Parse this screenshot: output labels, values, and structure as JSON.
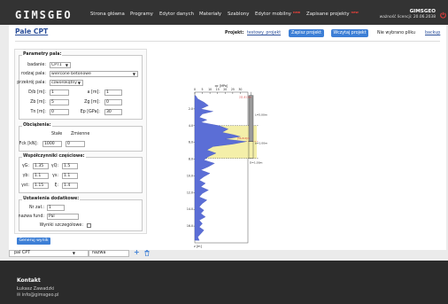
{
  "logo": "GIMSGEO",
  "nav": {
    "items": [
      {
        "label": "Strona główna",
        "new": ""
      },
      {
        "label": "Programy",
        "new": ""
      },
      {
        "label": "Edytor danych",
        "new": ""
      },
      {
        "label": "Materiały",
        "new": ""
      },
      {
        "label": "Szablony",
        "new": ""
      },
      {
        "label": "Edytor mobilny",
        "new": "new"
      },
      {
        "label": "Zapisane projekty",
        "new": "new"
      }
    ],
    "user": "GIMSGEO",
    "license": "ważność licencji: 20.06.2038"
  },
  "page_title": "Pale CPT",
  "project": {
    "label": "Projekt:",
    "name": "testowy_projekt",
    "save_button": "Zapisz projekt",
    "load_button": "Wczytaj projekt",
    "no_file": "Nie wybrano pliku",
    "backup": "backup"
  },
  "pile_params": {
    "legend": "Parametry pala:",
    "badanie_label": "badanie:",
    "badanie_value": "CPT1",
    "rodzaj_label": "rodzaj pala:",
    "rodzaj_value": "wiercone betonowe",
    "przekroj_label": "przekrój pala:",
    "przekroj_value": "czworokątny",
    "d_label": "D/b [m]:",
    "d_value": "1",
    "a_label": "a [m]:",
    "a_value": "1",
    "zb_label": "Zb [m]:",
    "zb_value": "5",
    "zg_label": "Zg [m]:",
    "zg_value": "0",
    "tn_label": "Tn [m]:",
    "tn_value": "0",
    "ep_label": "Ep [GPa]:",
    "ep_value": "30"
  },
  "loads": {
    "legend": "Obciążenia:",
    "stale_label": "Stałe",
    "zmienne_label": "Zmienne",
    "fck_label": "Fck [kN]:",
    "fck_value": "1000",
    "zmienne_value": "0"
  },
  "factors": {
    "legend": "Współczynniki częściowe:",
    "yg_label": "γG:",
    "yg_value": "1.35",
    "yq_label": "γQ:",
    "yq_value": "1.5",
    "yb_label": "γb:",
    "yb_value": "1.1",
    "ys_label": "γs:",
    "ys_value": "1.1",
    "yst_label": "γst:",
    "yst_value": "1.15",
    "xi_label": "ξ:",
    "xi_value": "1.4"
  },
  "extra": {
    "legend": "Ustawienia dodatkowe:",
    "nr_label": "Nr zał.:",
    "nr_value": "1",
    "fund_label": "nazwa fund:",
    "fund_value": "Pal",
    "details_label": "Wyniki szczegółowe:"
  },
  "generate_button": "Generuj wynik",
  "bottom": {
    "select_value": "pal CPT",
    "name_value": "nazwa"
  },
  "footer": {
    "title": "Kontakt",
    "name": "Łukasz Zawadzki",
    "email": "✉ info@gimsgeo.pl"
  },
  "chart_data": {
    "type": "line",
    "xlabel": "qc [MPa]",
    "ylabel": "z [m]",
    "x_ticks": [
      "0",
      "5",
      "10",
      "15",
      "20",
      "25",
      "30"
    ],
    "y_ticks": [
      "2.0",
      "4.0",
      "6.0",
      "8.0",
      "10.0",
      "12.0",
      "14.0",
      "16.0"
    ],
    "xlim": [
      0,
      35
    ],
    "ylim": [
      0,
      18
    ],
    "series": [
      {
        "points": [
          [
            0.5,
            0.4
          ],
          [
            2,
            0.8
          ],
          [
            6,
            1.2
          ],
          [
            9,
            1.6
          ],
          [
            4,
            2.0
          ],
          [
            12,
            2.3
          ],
          [
            5,
            2.6
          ],
          [
            3,
            3.0
          ],
          [
            8,
            3.3
          ],
          [
            4,
            3.6
          ],
          [
            16,
            4.0
          ],
          [
            22,
            4.4
          ],
          [
            18,
            4.8
          ],
          [
            26,
            5.1
          ],
          [
            30,
            5.3
          ],
          [
            20,
            5.6
          ],
          [
            34,
            5.9
          ],
          [
            25,
            6.2
          ],
          [
            12,
            6.5
          ],
          [
            8,
            6.9
          ],
          [
            14,
            7.3
          ],
          [
            9,
            7.7
          ],
          [
            6,
            8.1
          ],
          [
            13,
            8.5
          ],
          [
            9,
            8.9
          ],
          [
            4,
            9.3
          ],
          [
            10,
            9.7
          ],
          [
            6,
            10.1
          ],
          [
            3,
            10.5
          ],
          [
            7,
            10.9
          ],
          [
            4,
            11.3
          ],
          [
            9,
            11.7
          ],
          [
            5,
            12.1
          ],
          [
            3,
            12.5
          ],
          [
            8,
            12.9
          ],
          [
            5,
            13.3
          ],
          [
            3,
            13.7
          ],
          [
            6,
            14.1
          ],
          [
            4,
            14.5
          ],
          [
            7,
            14.9
          ],
          [
            3,
            15.3
          ],
          [
            5,
            15.7
          ],
          [
            3,
            16.1
          ],
          [
            6,
            16.5
          ],
          [
            4,
            16.9
          ],
          [
            2,
            17.3
          ],
          [
            3,
            17.7
          ]
        ]
      }
    ],
    "annotations": {
      "top_label": "2[1.8] 3m",
      "l_label": "L=5.00m",
      "mid_label": "[5b-8.0]m",
      "b_label": "b=1.00m",
      "d_label": "D=1.00m"
    },
    "colors": {
      "fill": "#5b6ed6",
      "band": "#f3eda0",
      "pile": "#9a9a9a",
      "red": "#d43a3a"
    }
  }
}
